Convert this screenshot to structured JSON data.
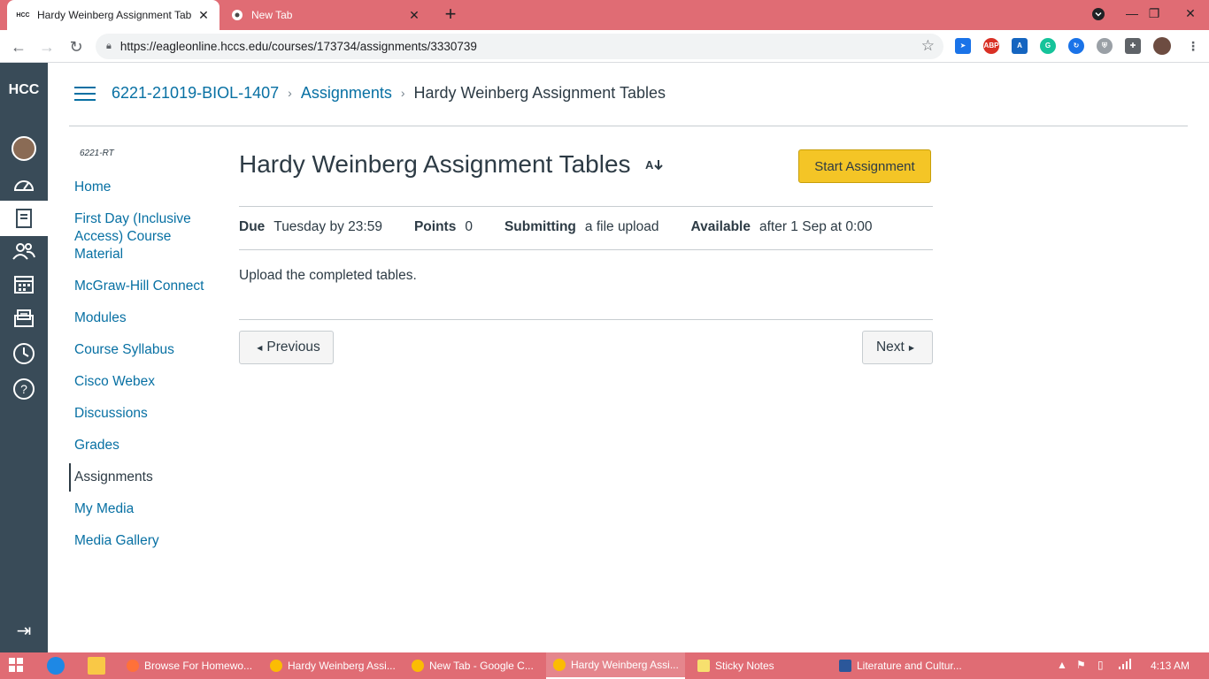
{
  "browser": {
    "tabs": [
      {
        "title": "Hardy Weinberg Assignment Tab",
        "favicon": "HCC"
      },
      {
        "title": "New Tab"
      }
    ],
    "url": "https://eagleonline.hccs.edu/courses/173734/assignments/3330739"
  },
  "global_nav": {
    "logo": "HCC"
  },
  "breadcrumb": {
    "course": "6221-21019-BIOL-1407",
    "section": "Assignments",
    "current": "Hardy Weinberg Assignment Tables"
  },
  "course_nav": {
    "code": "6221-RT",
    "items": [
      {
        "label": "Home"
      },
      {
        "label": "First Day (Inclusive Access) Course Material"
      },
      {
        "label": "McGraw-Hill Connect"
      },
      {
        "label": "Modules"
      },
      {
        "label": "Course Syllabus"
      },
      {
        "label": "Cisco Webex"
      },
      {
        "label": "Discussions"
      },
      {
        "label": "Grades"
      },
      {
        "label": "Assignments"
      },
      {
        "label": "My Media"
      },
      {
        "label": "Media Gallery"
      }
    ]
  },
  "assignment": {
    "title": "Hardy Weinberg Assignment Tables",
    "start_label": "Start Assignment",
    "due_label": "Due",
    "due_value": "Tuesday by 23:59",
    "points_label": "Points",
    "points_value": "0",
    "submitting_label": "Submitting",
    "submitting_value": "a file upload",
    "available_label": "Available",
    "available_value": "after 1 Sep at 0:00",
    "description": "Upload the completed tables.",
    "previous_label": "Previous",
    "next_label": "Next"
  },
  "taskbar": {
    "apps": [
      {
        "label": "Browse For Homewo..."
      },
      {
        "label": "Hardy Weinberg Assi..."
      },
      {
        "label": "New Tab - Google C..."
      },
      {
        "label": "Hardy Weinberg Assi..."
      },
      {
        "label": "Sticky Notes"
      },
      {
        "label": "Literature and Cultur..."
      }
    ],
    "clock": "4:13 AM"
  },
  "colors": {
    "chrome_frame": "#e06c74",
    "canvas_nav": "#394b58",
    "link": "#0770a3",
    "start_button": "#f4c526"
  }
}
